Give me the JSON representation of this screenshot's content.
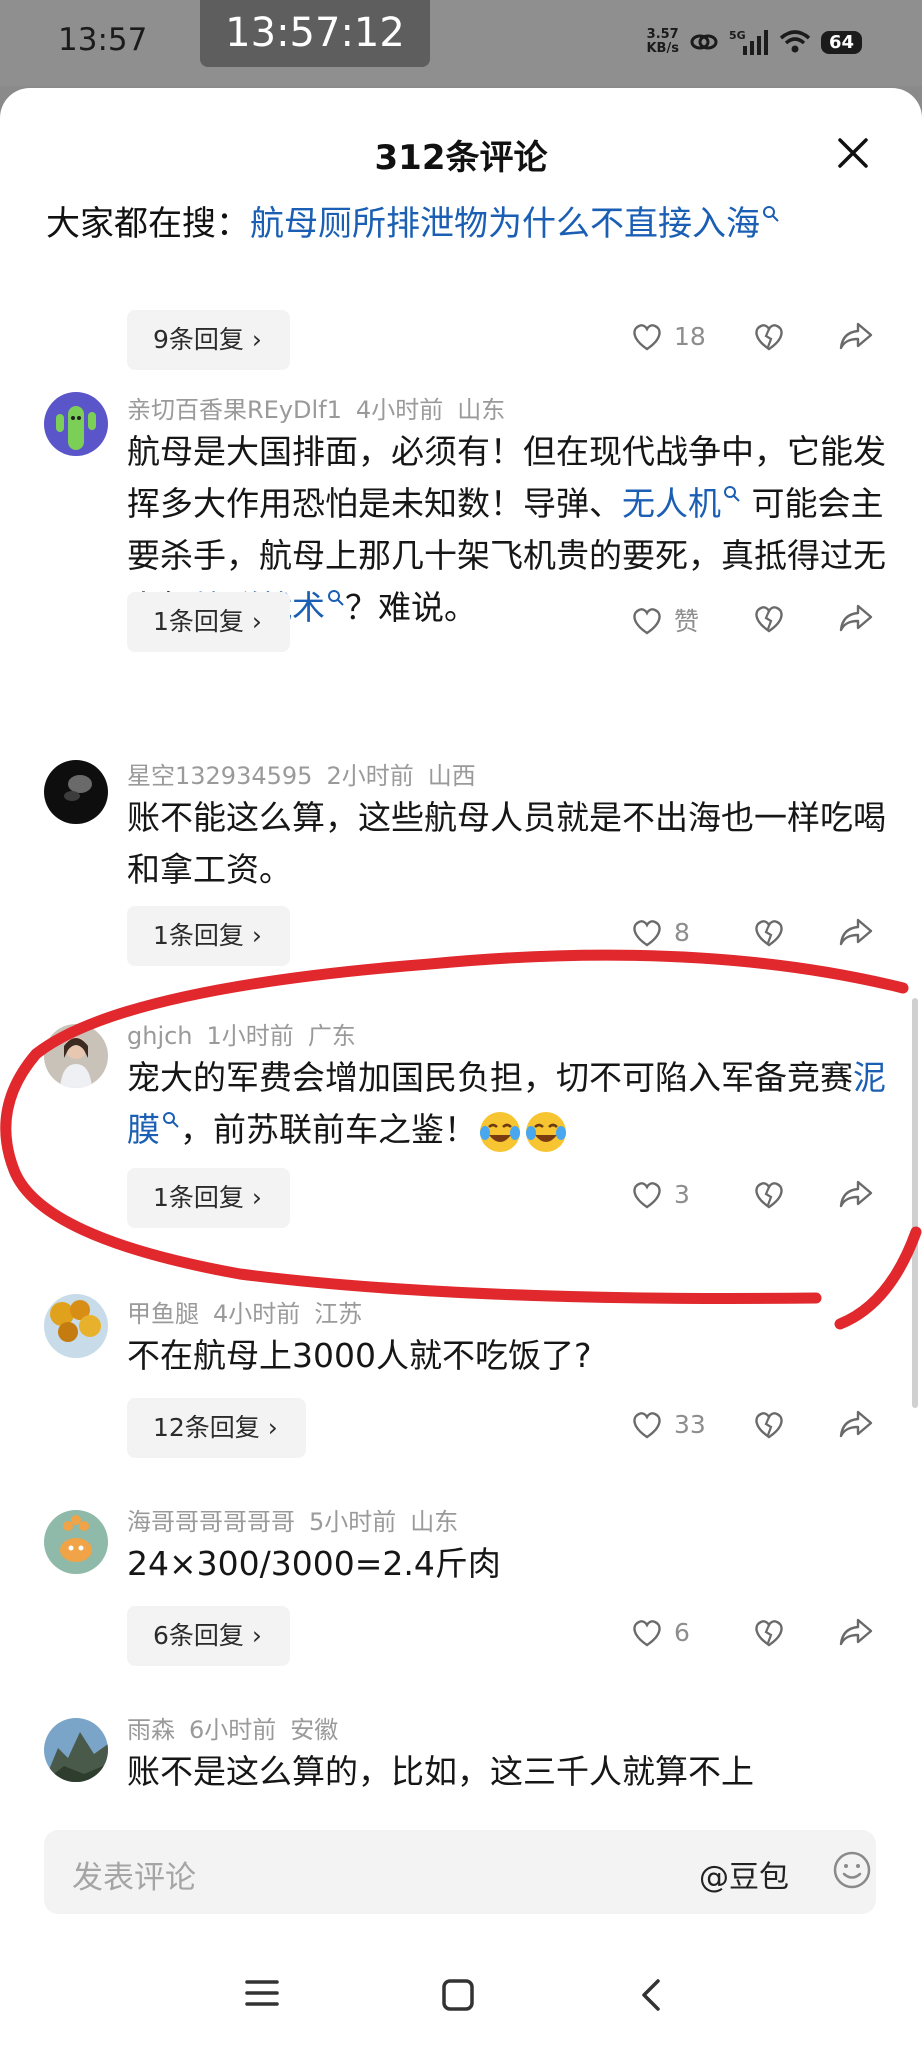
{
  "status": {
    "time": "13:57",
    "overlay_clock": "13:57:12",
    "net_speed_value": "3.57",
    "net_speed_unit": "KB/s",
    "signal_label": "5G",
    "battery": "64"
  },
  "sheet": {
    "title": "312条评论",
    "hot_prefix": "大家都在搜：",
    "hot_link": "航母厕所排泄物为什么不直接入海"
  },
  "first_thread": {
    "reply": "9条回复",
    "likes": "18"
  },
  "comments": [
    {
      "user": "亲切百香果REyDlf1",
      "time": "4小时前",
      "region": "山东",
      "t1": "航母是大国排面，必须有！但在现代战争中，它能发挥多大作用恐怕是未知数！导弹、",
      "l1": "无人机",
      "t2": " 可能会主要杀手，航母上那几十架飞机贵的要死，真抵得过无人机",
      "l2": "蜂群战术",
      "t3": "？难说。",
      "reply": "1条回复",
      "likes": "赞"
    },
    {
      "user": "星空132934595",
      "time": "2小时前",
      "region": "山西",
      "t1": "账不能这么算，这些航母人员就是不出海也一样吃喝和拿工资。",
      "reply": "1条回复",
      "likes": "8"
    },
    {
      "user": "ghjch",
      "time": "1小时前",
      "region": "广东",
      "t1": "宠大的军费会增加国民负担，切不可陷入军备竞赛",
      "l1": "泥膜",
      "t2": "，前苏联前车之鉴！",
      "reply": "1条回复",
      "likes": "3"
    },
    {
      "user": "甲鱼腿",
      "time": "4小时前",
      "region": "江苏",
      "t1": "不在航母上3000人就不吃饭了?",
      "reply": "12条回复",
      "likes": "33"
    },
    {
      "user": "海哥哥哥哥哥哥",
      "time": "5小时前",
      "region": "山东",
      "t1": "24×300/3000=2.4斤肉",
      "reply": "6条回复",
      "likes": "6"
    },
    {
      "user": "雨森",
      "time": "6小时前",
      "region": "安徽",
      "t1": "账不是这么算的，比如，这三千人就算不上"
    }
  ],
  "input": {
    "placeholder": "发表评论",
    "at_label": "@豆包"
  },
  "icons": {
    "close": "close-icon",
    "like": "heart-icon",
    "dislike": "broken-heart-icon",
    "share": "share-icon",
    "search": "search-icon",
    "smile": "smile-icon",
    "emoji": "crying-laughing-emoji"
  },
  "colors": {
    "link": "#1b5fb4",
    "annotation": "#e0282d",
    "muted": "#9a9a9a"
  }
}
